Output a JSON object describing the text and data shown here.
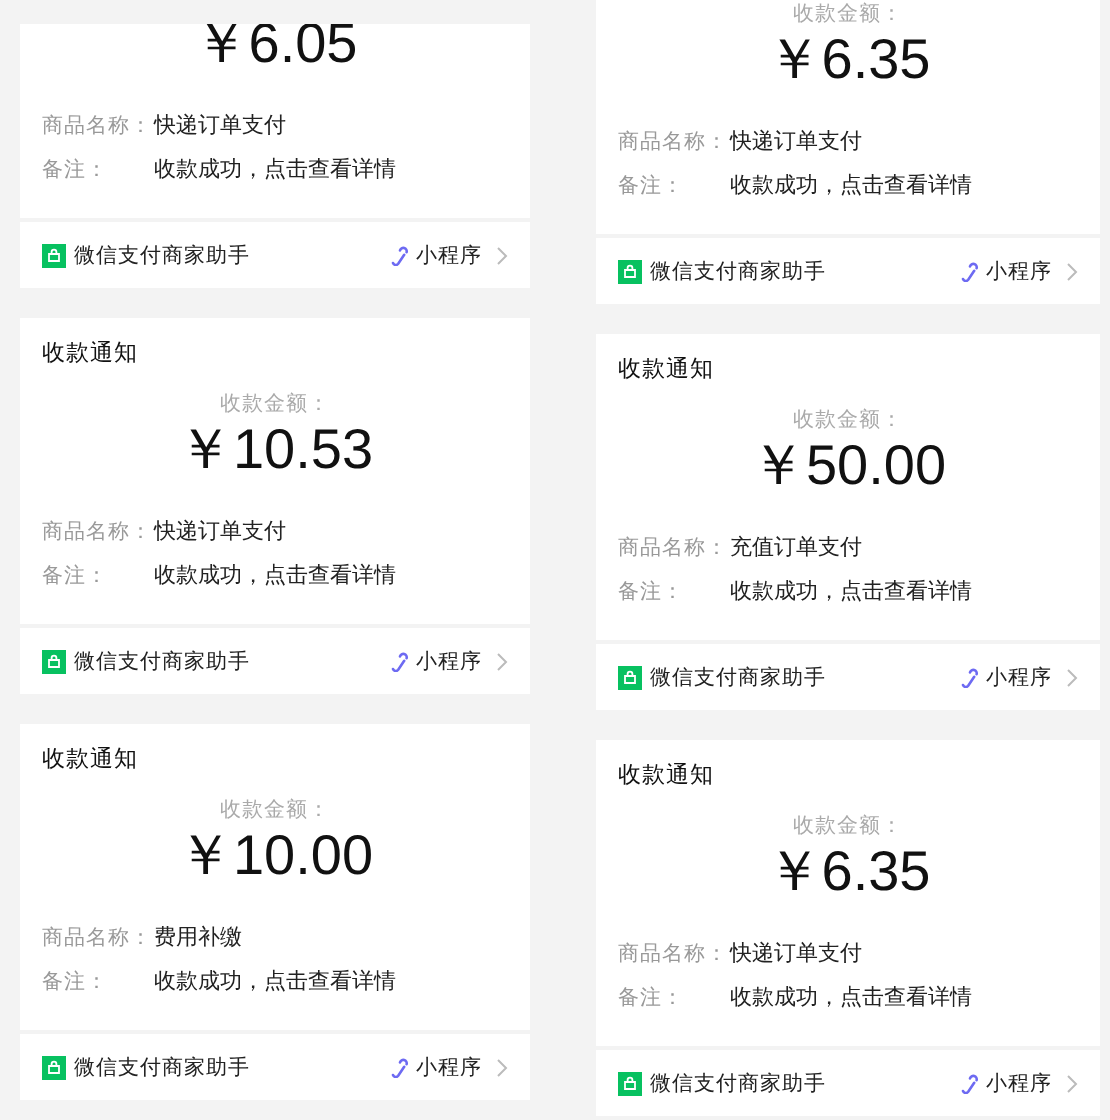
{
  "columns": [
    {
      "cards": [
        {
          "amount": "￥6.05",
          "fields": [
            {
              "label": "商品名称：",
              "value": "快递订单支付"
            },
            {
              "label": "备注：",
              "value": "收款成功，点击查看详情"
            }
          ],
          "footer": {
            "source": "微信支付商家助手",
            "link": "小程序"
          }
        },
        {
          "title": "收款通知",
          "amount_label": "收款金额：",
          "amount": "￥10.53",
          "fields": [
            {
              "label": "商品名称：",
              "value": "快递订单支付"
            },
            {
              "label": "备注：",
              "value": "收款成功，点击查看详情"
            }
          ],
          "footer": {
            "source": "微信支付商家助手",
            "link": "小程序"
          }
        },
        {
          "title": "收款通知",
          "amount_label": "收款金额：",
          "amount": "￥10.00",
          "fields": [
            {
              "label": "商品名称：",
              "value": "费用补缴"
            },
            {
              "label": "备注：",
              "value": "收款成功，点击查看详情"
            }
          ],
          "footer": {
            "source": "微信支付商家助手",
            "link": "小程序"
          }
        }
      ]
    },
    {
      "cards": [
        {
          "amount_label": "收款金额：",
          "amount": "￥6.35",
          "fields": [
            {
              "label": "商品名称：",
              "value": "快递订单支付"
            },
            {
              "label": "备注：",
              "value": "收款成功，点击查看详情"
            }
          ],
          "footer": {
            "source": "微信支付商家助手",
            "link": "小程序"
          }
        },
        {
          "title": "收款通知",
          "amount_label": "收款金额：",
          "amount": "￥50.00",
          "fields": [
            {
              "label": "商品名称：",
              "value": "充值订单支付"
            },
            {
              "label": "备注：",
              "value": "收款成功，点击查看详情"
            }
          ],
          "footer": {
            "source": "微信支付商家助手",
            "link": "小程序"
          }
        },
        {
          "title": "收款通知",
          "amount_label": "收款金额：",
          "amount": "￥6.35",
          "fields": [
            {
              "label": "商品名称：",
              "value": "快递订单支付"
            },
            {
              "label": "备注：",
              "value": "收款成功，点击查看详情"
            }
          ],
          "footer": {
            "source": "微信支付商家助手",
            "link": "小程序"
          }
        }
      ]
    }
  ]
}
